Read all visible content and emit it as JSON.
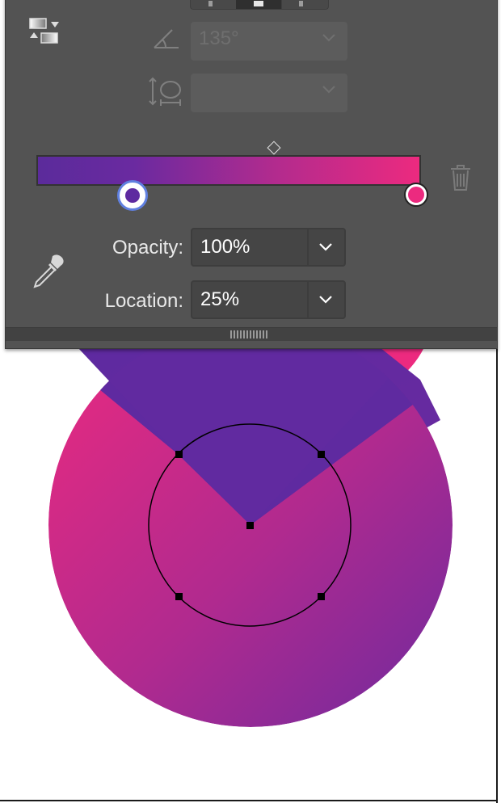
{
  "canvas": {
    "background": "#ffffff"
  },
  "gradient_panel": {
    "angle": {
      "value": "135°",
      "enabled": false
    },
    "aspect_ratio": {
      "value": "",
      "enabled": false
    },
    "gradient": {
      "colors": [
        "#5b2b9b",
        "#6a2aa0",
        "#b22b8e",
        "#ec2a7f"
      ],
      "stops": [
        {
          "color": "#5e2aa0",
          "location_percent": 25,
          "selected": true
        },
        {
          "color": "#ec2a7f",
          "location_percent": 100,
          "selected": false
        }
      ]
    },
    "opacity": {
      "label": "Opacity:",
      "value": "100%"
    },
    "location": {
      "label": "Location:",
      "value": "25%"
    }
  },
  "icons": {
    "reverse_gradient": "reverse-gradient-icon",
    "angle": "angle-icon",
    "aspect_ratio": "aspect-ratio-icon",
    "delete_stop": "trash-icon",
    "eyedropper": "eyedropper-icon",
    "chevron": "chevron-down-icon"
  }
}
